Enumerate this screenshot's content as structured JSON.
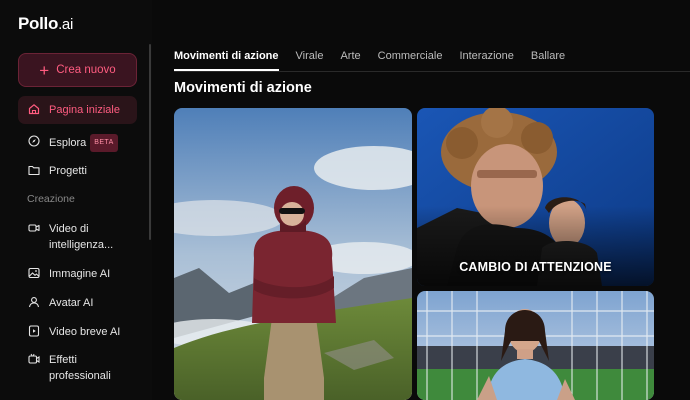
{
  "app": {
    "logo_main": "Pollo",
    "logo_suffix": ".ai"
  },
  "sidebar": {
    "create_label": "Crea nuovo",
    "items": [
      {
        "label": "Pagina iniziale",
        "icon": "home-icon",
        "active": true
      },
      {
        "label": "Esplora",
        "icon": "compass-icon",
        "badge": "BETA"
      },
      {
        "label": "Progetti",
        "icon": "folder-icon"
      }
    ],
    "section_label": "Creazione",
    "creation_items": [
      {
        "label": "Video di intelligenza...",
        "icon": "video-ai-icon"
      },
      {
        "label": "Immagine AI",
        "icon": "image-ai-icon"
      },
      {
        "label": "Avatar AI",
        "icon": "avatar-icon"
      },
      {
        "label": "Video breve AI",
        "icon": "short-video-icon"
      },
      {
        "label": "Effetti professionali",
        "icon": "effects-icon"
      }
    ]
  },
  "tabs": [
    {
      "label": "Movimenti di azione",
      "active": true
    },
    {
      "label": "Virale"
    },
    {
      "label": "Arte"
    },
    {
      "label": "Commerciale"
    },
    {
      "label": "Interazione"
    },
    {
      "label": "Ballare"
    }
  ],
  "main": {
    "title": "Movimenti di azione",
    "cards": [
      {
        "caption": ""
      },
      {
        "caption": "CAMBIO DI ATTENZIONE"
      },
      {
        "caption": ""
      }
    ]
  },
  "colors": {
    "accent": "#ff5c80",
    "background": "#0a0a0a"
  }
}
